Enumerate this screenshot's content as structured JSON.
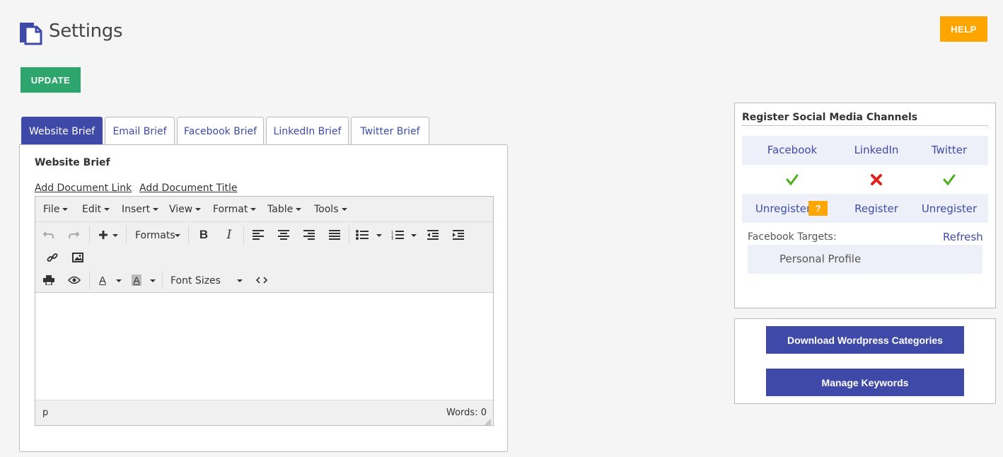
{
  "header": {
    "title": "Settings",
    "help_label": "HELP",
    "update_label": "UPDATE",
    "accent": "#3f4aa8",
    "help_color": "#ffa500",
    "update_color": "#2da56d"
  },
  "tabs": [
    {
      "label": "Website Brief",
      "active": true
    },
    {
      "label": "Email Brief",
      "active": false
    },
    {
      "label": "Facebook Brief",
      "active": false
    },
    {
      "label": "LinkedIn Brief",
      "active": false
    },
    {
      "label": "Twitter Brief",
      "active": false
    }
  ],
  "brief": {
    "heading": "Website Brief",
    "add_link_label": "Add Document Link",
    "add_title_label": "Add Document Title"
  },
  "editor": {
    "menus": [
      "File",
      "Edit",
      "Insert",
      "View",
      "Format",
      "Table",
      "Tools"
    ],
    "formats_label": "Formats",
    "font_sizes_label": "Font Sizes",
    "text_color_glyph": "A",
    "bg_color_glyph": "A",
    "bold_glyph": "B",
    "italic_glyph": "I",
    "status_path": "p",
    "word_count": "Words: 0"
  },
  "social": {
    "title": "Register Social Media Channels",
    "channels": [
      {
        "name": "Facebook",
        "registered": true,
        "action": "Unregister",
        "status_icon": "check-icon"
      },
      {
        "name": "LinkedIn",
        "registered": false,
        "action": "Register",
        "status_icon": "cross-icon"
      },
      {
        "name": "Twitter",
        "registered": true,
        "action": "Unregister",
        "status_icon": "check-icon"
      }
    ],
    "info_badge": "?",
    "targets_label": "Facebook Targets:",
    "refresh_label": "Refresh",
    "targets": [
      "Personal Profile"
    ]
  },
  "actions": {
    "download_label": "Download Wordpress Categories",
    "keywords_label": "Manage Keywords"
  }
}
